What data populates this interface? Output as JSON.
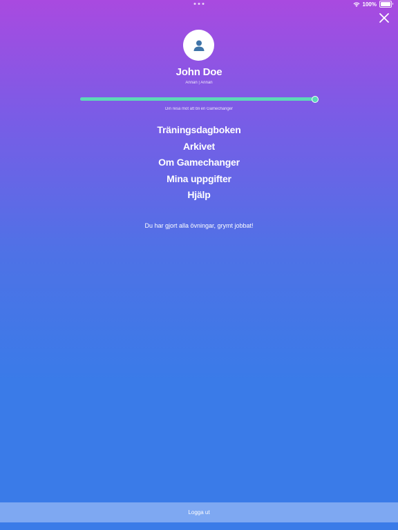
{
  "status_bar": {
    "battery_text": "100%",
    "icons": [
      "wifi-icon",
      "battery-icon"
    ]
  },
  "profile": {
    "name": "John Doe",
    "subtitle": "Annan | Annan",
    "avatar_icon": "person-icon"
  },
  "progress": {
    "value": 1.0,
    "caption": "Din resa mot att bli en Gamechanger",
    "color": "#5cd8b8"
  },
  "menu": {
    "items": [
      {
        "label": "Träningsdagboken"
      },
      {
        "label": "Arkivet"
      },
      {
        "label": "Om Gamechanger"
      },
      {
        "label": "Mina uppgifter"
      },
      {
        "label": "Hjälp"
      }
    ]
  },
  "message": "Du har gjort alla övningar, grymt jobbat!",
  "footer": {
    "logout_label": "Logga ut"
  },
  "colors": {
    "gradient_top": "#a94ae0",
    "gradient_bottom": "#3a7be8",
    "accent": "#5cd8b8"
  }
}
